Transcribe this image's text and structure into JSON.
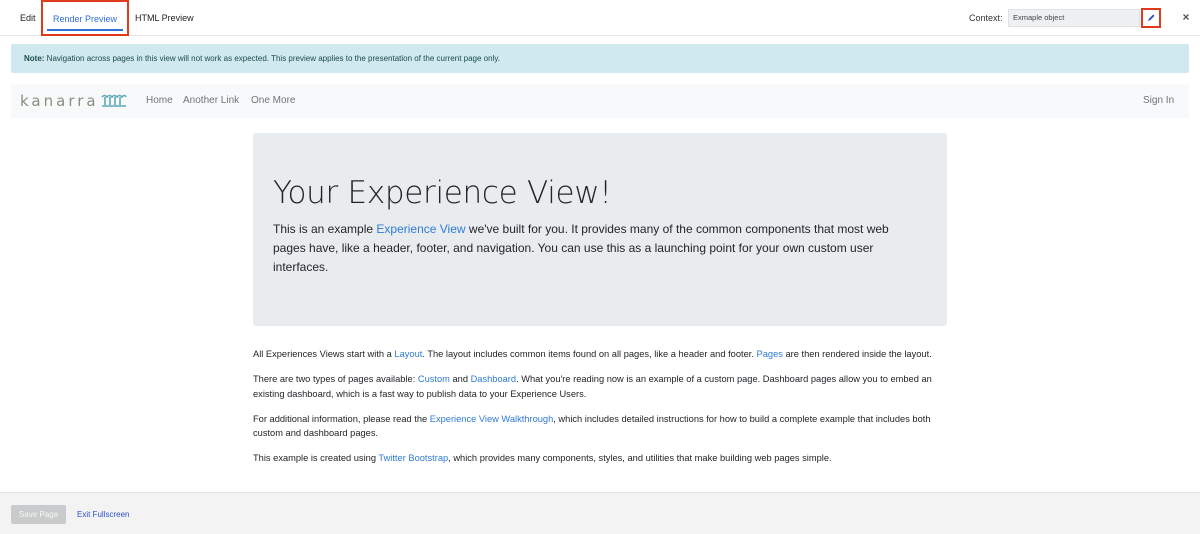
{
  "tabs": {
    "edit": "Edit",
    "render_preview": "Render Preview",
    "html_preview": "HTML Preview"
  },
  "context": {
    "label": "Context:",
    "value": "Exmaple object"
  },
  "note": {
    "prefix": "Note:",
    "text": " Navigation across pages in this view will not work as expected. This preview applies to the presentation of the current page only."
  },
  "navbar": {
    "logo": "kanarra",
    "links": [
      "Home",
      "Another Link",
      "One More"
    ],
    "sign_in": "Sign In"
  },
  "jumbotron": {
    "title": "Your Experience View!",
    "lead_before": "This is an example ",
    "lead_link": "Experience View",
    "lead_after": " we've built for you. It provides many of the common components that most web pages have, like a header, footer, and navigation. You can use this as a launching point for your own custom user interfaces."
  },
  "paragraphs": {
    "p1": {
      "t1": "All Experiences Views start with a ",
      "l1": "Layout",
      "t2": ". The layout includes common items found on all pages, like a header and footer. ",
      "l2": "Pages",
      "t3": " are then rendered inside the layout."
    },
    "p2": {
      "t1": "There are two types of pages available: ",
      "l1": "Custom",
      "t2": " and ",
      "l2": "Dashboard",
      "t3": ". What you're reading now is an example of a custom page. Dashboard pages allow you to embed an existing dashboard, which is a fast way to publish data to your Experience Users."
    },
    "p3": {
      "t1": "For additional information, please read the ",
      "l1": "Experience View Walkthrough",
      "t2": ", which includes detailed instructions for how to build a complete example that includes both custom and dashboard pages."
    },
    "p4": {
      "t1": "This example is created using ",
      "l1": "Twitter Bootstrap",
      "t2": ", which provides many components, styles, and utilities that make building web pages simple."
    }
  },
  "footer": {
    "save": "Save Page",
    "exit": "Exit Fullscreen"
  },
  "colors": {
    "active_tab": "#2f6fd6",
    "highlight_box": "#e03a1c",
    "note_bg": "#cfe9ee",
    "link": "#2f7bd6",
    "jumbotron_bg": "#e9ecef"
  },
  "icons": {
    "edit": "pencil-icon",
    "close": "close-icon",
    "logo_mark": "waves-logo-icon"
  }
}
